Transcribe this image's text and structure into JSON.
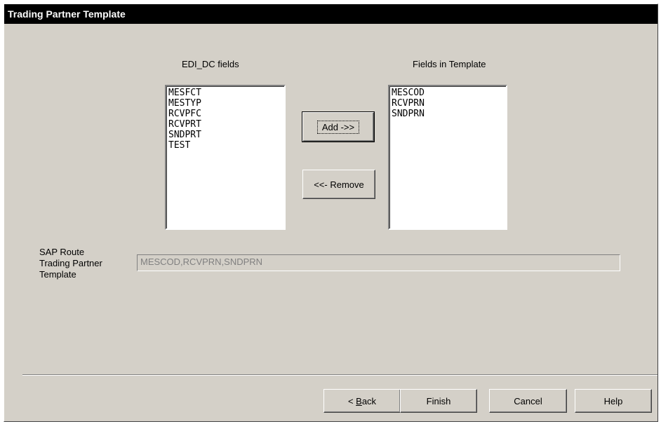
{
  "window": {
    "title": "Trading Partner Template"
  },
  "source_list": {
    "label": "EDI_DC fields",
    "items": [
      "MESFCT",
      "MESTYP",
      "RCVPFC",
      "RCVPRT",
      "SNDPRT",
      "TEST"
    ]
  },
  "target_list": {
    "label": "Fields in Template",
    "items": [
      "MESCOD",
      "RCVPRN",
      "SNDPRN"
    ]
  },
  "actions": {
    "add_label": "Add ->>",
    "remove_label": "<<- Remove"
  },
  "route": {
    "label_line1": "SAP Route",
    "label_line2": "Trading Partner",
    "label_line3": "Template",
    "value": "MESCOD,RCVPRN,SNDPRN"
  },
  "footer": {
    "back_prefix": "< ",
    "back_accel": "B",
    "back_rest": "ack",
    "finish_label": "Finish",
    "cancel_label": "Cancel",
    "help_label": "Help"
  }
}
